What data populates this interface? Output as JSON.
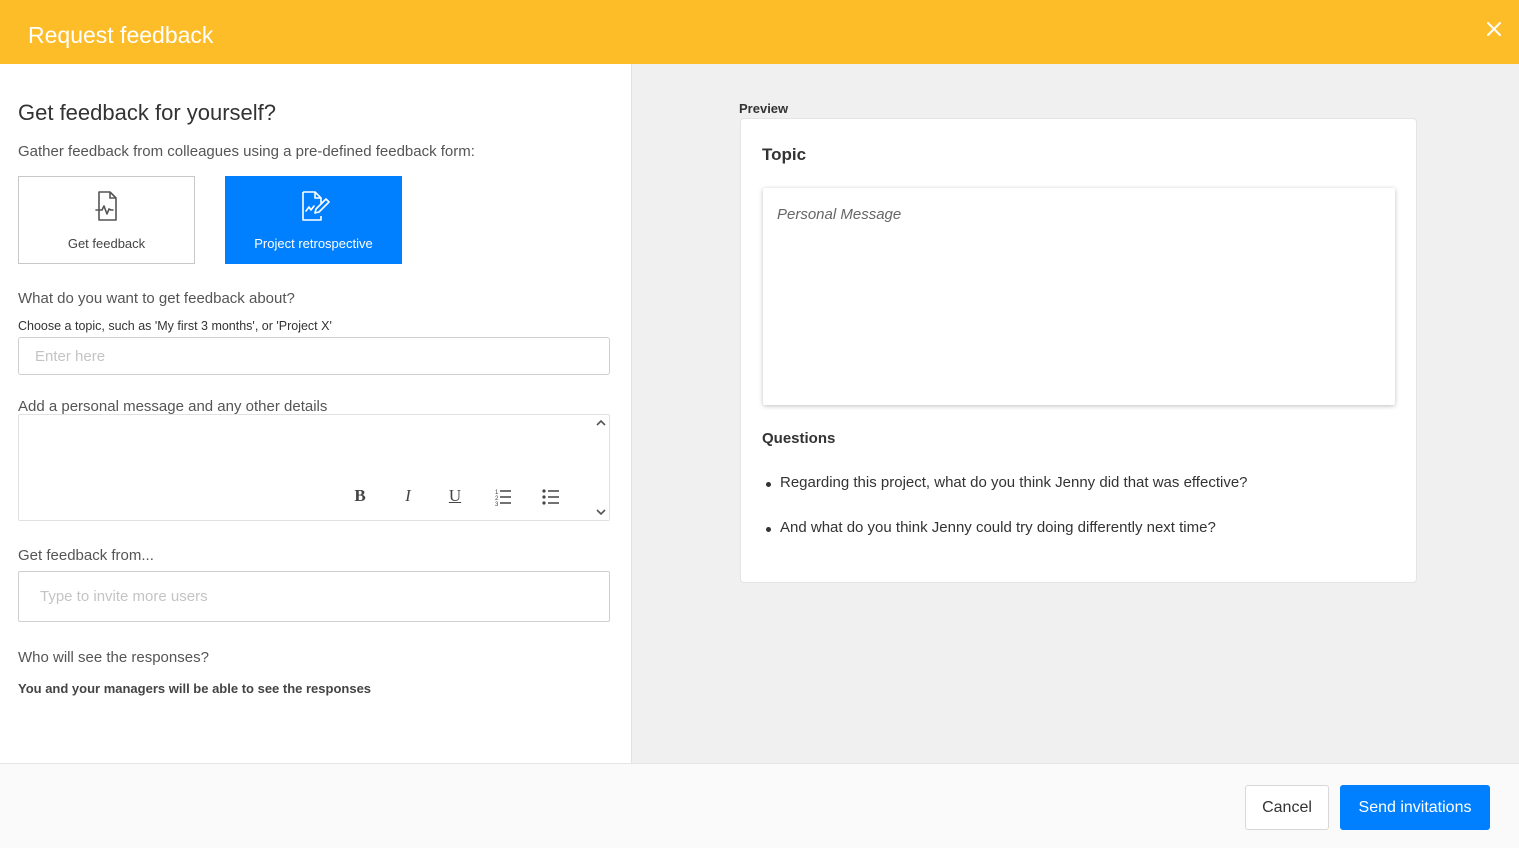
{
  "header": {
    "title": "Request feedback",
    "close_icon": "close-icon"
  },
  "form": {
    "heading": "Get feedback for yourself?",
    "subheading": "Gather feedback from colleagues using a pre-defined feedback form:",
    "types": [
      {
        "label": "Get feedback",
        "icon": "document-pulse-icon",
        "selected": false
      },
      {
        "label": "Project retrospective",
        "icon": "document-edit-icon",
        "selected": true
      }
    ],
    "topic": {
      "label": "What do you want to get feedback about?",
      "hint": "Choose a topic, such as 'My first 3 months', or 'Project X'",
      "placeholder": "Enter here",
      "value": ""
    },
    "message": {
      "label": "Add a personal message and any other details",
      "toolbar": {
        "bold": "B",
        "italic": "I",
        "underline": "U",
        "ordered_list": "ordered-list-icon",
        "bullet_list": "bullet-list-icon"
      }
    },
    "recipients": {
      "label": "Get feedback from...",
      "placeholder": "Type to invite more users"
    },
    "visibility": {
      "label": "Who will see the responses?",
      "text": "You and your managers will be able to see the responses"
    }
  },
  "preview": {
    "label": "Preview",
    "topic": "Topic",
    "message_placeholder": "Personal Message",
    "questions_heading": "Questions",
    "questions": [
      "Regarding this project, what do you think Jenny did that was effective?",
      "And what do you think Jenny could try doing differently next time?"
    ]
  },
  "footer": {
    "cancel_label": "Cancel",
    "send_label": "Send invitations"
  },
  "colors": {
    "header_bg": "#fdbd28",
    "accent": "#0080ff",
    "preview_bg": "#f0f0f0"
  }
}
